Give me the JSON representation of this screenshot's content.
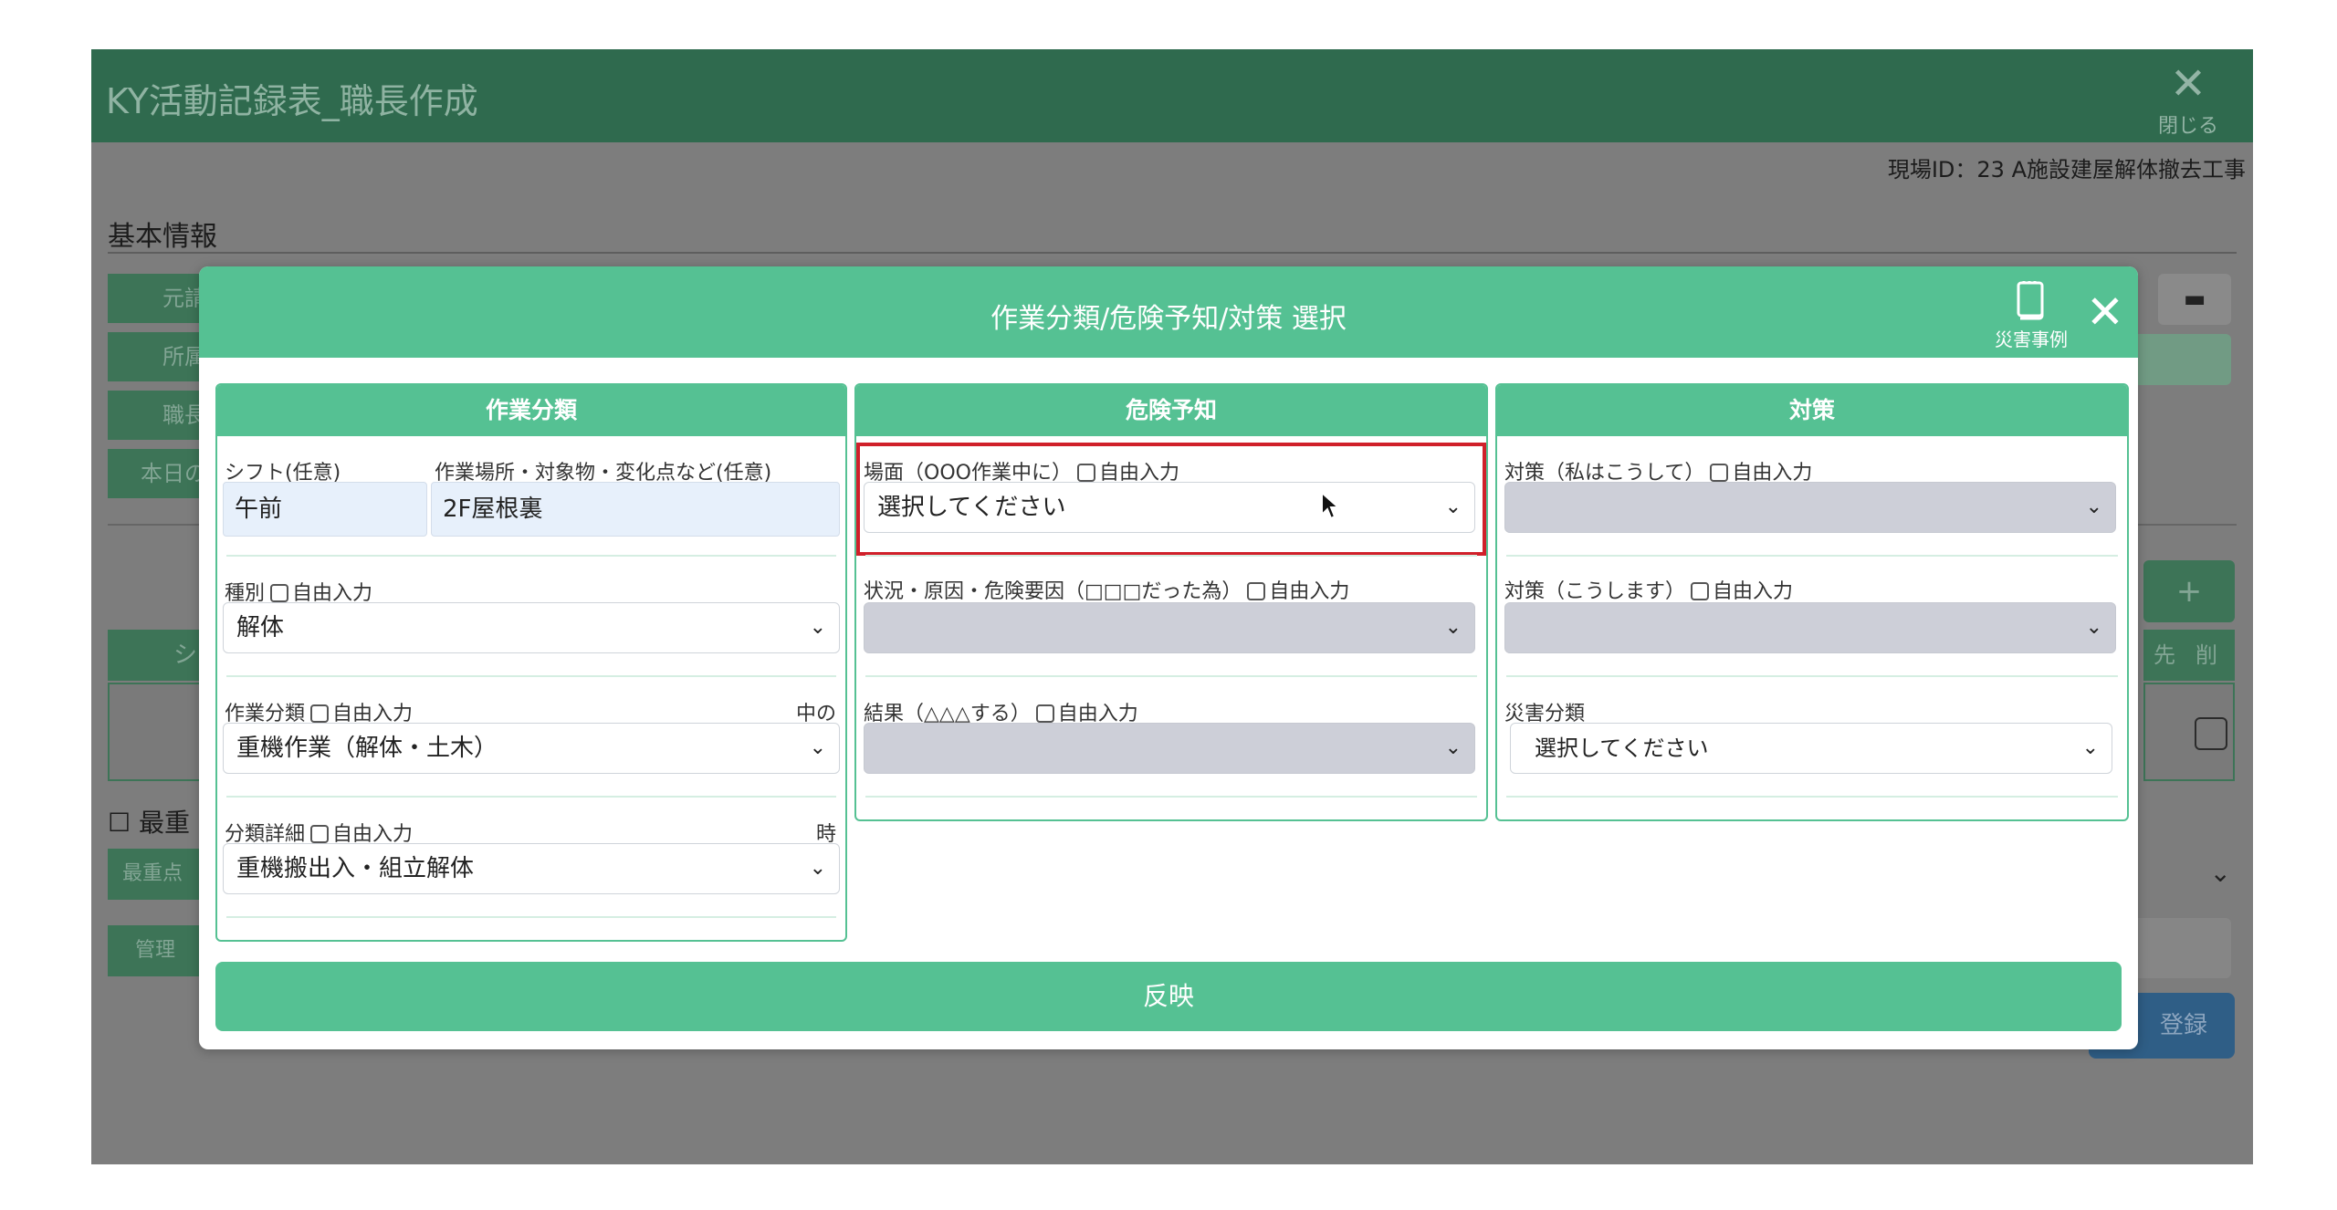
{
  "app": {
    "title": "KY活動記録表_職長作成",
    "close_label": "閉じる",
    "site_id": "現場ID：23 A施設建屋解体撤去工事",
    "basic_info": "基本情報",
    "bg_labels": [
      "元請",
      "所属",
      "職長",
      "本日の"
    ],
    "table_header_left": "シ",
    "table_header_right": [
      "先",
      "削"
    ],
    "plus_label": "+",
    "saijuu_label": "最重",
    "saijuu_field": "最重点",
    "kanri_label": "管理",
    "register_label": "登録"
  },
  "modal": {
    "title": "作業分類/危険予知/対策 選択",
    "disaster_cases_label": "災害事例",
    "close_symbol": "✕",
    "apply_label": "反映",
    "work": {
      "heading": "作業分類",
      "shift_label": "シフト(任意)",
      "shift_value": "午前",
      "place_label": "作業場所・対象物・変化点など(任意)",
      "place_value": "2F屋根裏",
      "type_label": "種別",
      "type_value": "解体",
      "category_label": "作業分類",
      "category_note": "中の",
      "category_value": "重機作業（解体・土木）",
      "detail_label": "分類詳細",
      "detail_note": "時",
      "detail_value": "重機搬出入・組立解体"
    },
    "hazard": {
      "heading": "危険予知",
      "scene_label": "場面（OOO作業中に）",
      "scene_value": "選択してください",
      "situation_label": "状況・原因・危険要因（□□□だった為）",
      "situation_value": "",
      "result_label": "結果（△△△する）",
      "result_value": ""
    },
    "measure": {
      "heading": "対策",
      "measure1_label": "対策（私はこうして）",
      "measure1_value": "",
      "measure2_label": "対策（こうします）",
      "measure2_value": "",
      "disaster_label": "災害分類",
      "disaster_value": "選択してください"
    },
    "free_input_label": "自由入力"
  },
  "colors": {
    "accent": "#55c193",
    "header_dark": "#2f6a4e",
    "highlight": "#d0202a"
  }
}
